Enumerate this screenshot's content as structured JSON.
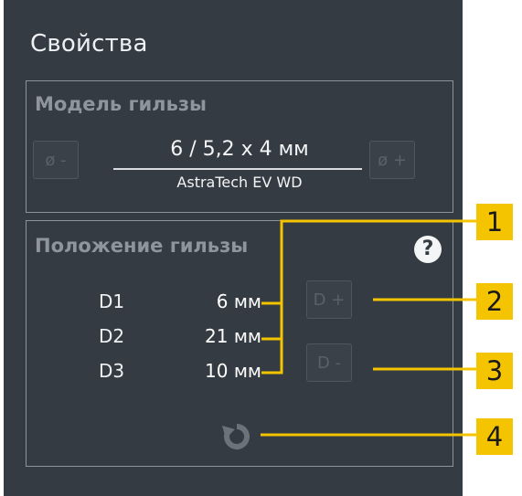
{
  "panel": {
    "title": "Свойства"
  },
  "model_group": {
    "title": "Модель гильзы",
    "dia_minus_label": "ø -",
    "dia_plus_label": "ø +",
    "size": "6 / 5,2 x 4 мм",
    "implant": "AstraTech EV WD"
  },
  "position_group": {
    "title": "Положение гильзы",
    "help_icon": "?",
    "rows": [
      {
        "label": "D1",
        "value": "6 мм"
      },
      {
        "label": "D2",
        "value": "21 мм"
      },
      {
        "label": "D3",
        "value": "10 мм"
      }
    ],
    "d_plus_label": "D +",
    "d_minus_label": "D -",
    "reset_icon": "reset-icon"
  },
  "callouts": [
    "1",
    "2",
    "3",
    "4"
  ],
  "colors": {
    "panel_bg": "#353b42",
    "callout": "#f5c400",
    "leader": "#f5c400"
  }
}
